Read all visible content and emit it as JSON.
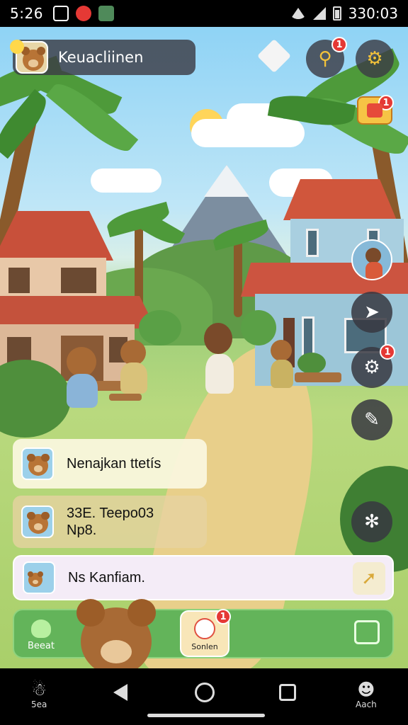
{
  "status_bar": {
    "time": "5:26",
    "right_text": "330:03",
    "icons": [
      "image-icon",
      "notification-icon",
      "shield-icon",
      "wifi-icon",
      "signal-icon",
      "battery-icon"
    ]
  },
  "hud": {
    "profile_name": "Keuacliinen",
    "search_badge": "1",
    "gift_badge": "1"
  },
  "right_rail": {
    "settings_badge": "1"
  },
  "quests": [
    {
      "label": "Nenajkan ttetís"
    },
    {
      "label_line1": "33E. Teepo03",
      "label_line2": "Np8."
    },
    {
      "label": "Ns Kanfiam."
    }
  ],
  "bottom_bar": {
    "left_label": "Beeat",
    "center_label": "Sonlen",
    "center_badge": "1"
  },
  "nav_bar": {
    "left_label": "5ea",
    "right_label": "Aach"
  },
  "colors": {
    "hud_dark": "#3c3c46",
    "badge_red": "#e53935",
    "bottom_green": "#63b45a",
    "panel_cream": "#faf6de"
  }
}
